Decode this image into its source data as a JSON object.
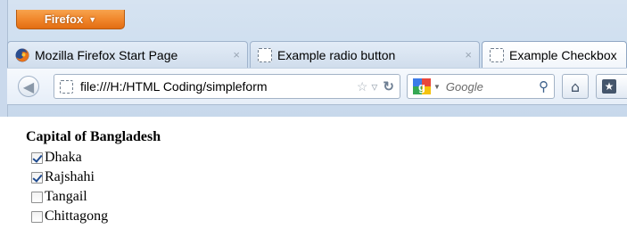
{
  "browser": {
    "app_button_label": "Firefox",
    "tabs": [
      {
        "label": "Mozilla Firefox Start Page",
        "icon": "firefox-icon",
        "active": false
      },
      {
        "label": "Example radio button",
        "icon": "blank-page-icon",
        "active": false
      },
      {
        "label": "Example Checkbox",
        "icon": "blank-page-icon",
        "active": true
      }
    ],
    "tab_close_glyph": "×",
    "url": "file:///H:/HTML Coding/simpleform",
    "search_placeholder": "Google"
  },
  "page": {
    "heading": "Capital of Bangladesh",
    "options": [
      {
        "label": "Dhaka",
        "checked": true
      },
      {
        "label": "Rajshahi",
        "checked": true
      },
      {
        "label": "Tangail",
        "checked": false
      },
      {
        "label": "Chittagong",
        "checked": false
      }
    ]
  },
  "colors": {
    "firefox_button": "#f0852a",
    "chrome_background": "#cfdff0",
    "checkmark": "#1f4b8f"
  }
}
